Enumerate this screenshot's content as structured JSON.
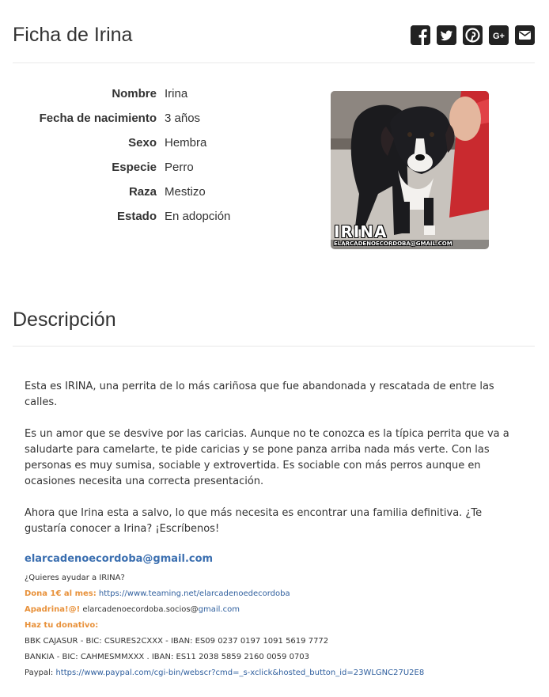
{
  "header": {
    "title": "Ficha de Irina",
    "share_buttons": [
      "facebook-icon",
      "twitter-icon",
      "pinterest-icon",
      "google-plus-icon",
      "email-icon"
    ],
    "gplus_text": "G+"
  },
  "facts": [
    {
      "label": "Nombre",
      "value": "Irina"
    },
    {
      "label": "Fecha de nacimiento",
      "value": "3 años"
    },
    {
      "label": "Sexo",
      "value": "Hembra"
    },
    {
      "label": "Especie",
      "value": "Perro"
    },
    {
      "label": "Raza",
      "value": "Mestizo"
    },
    {
      "label": "Estado",
      "value": "En adopción"
    }
  ],
  "photo": {
    "caption_name": "IRINA",
    "caption_email": "ELARCADENOECORDOBA@GMAIL.COM"
  },
  "description": {
    "title": "Descripción",
    "paragraphs": [
      "Esta es IRINA, una perrita de lo más cariñosa que fue abandonada y rescatada de entre las calles.",
      "Es un amor que se desvive por las caricias. Aunque no te conozca es la típica perrita que va a saludarte para camelarte, te pide caricias y se pone panza arriba nada más verte. Con las personas es muy sumisa, sociable y extrovertida. Es sociable con más perros aunque en ocasiones necesita una correcta presentación.",
      "Ahora que Irina esta a salvo, lo que más necesita es encontrar una familia definitiva. ¿Te gustaría conocer a Irina? ¡Escríbenos!"
    ],
    "email": "elarcadenoecordoba@gmail.com"
  },
  "help": {
    "question": "¿Quieres ayudar a IRINA?",
    "donate_label": "Dona 1€ al mes:",
    "donate_link": "https://www.teaming.net/elarcadenoedecordoba",
    "sponsor_label": "Apadrina!@!",
    "sponsor_text": "elarcadenoecordoba.socios@",
    "sponsor_link": "gmail.com",
    "donation_label": "Haz tu donativo:",
    "bank1": "BBK CAJASUR - BIC: CSURES2CXXX - IBAN: ES09 0237 0197 1091 5619 7772",
    "bank2": "BANKIA - BIC: CAHMESMMXXX . IBAN: ES11 2038 5859 2160 0059 0703",
    "paypal_label": "Paypal:",
    "paypal_link": "https://www.paypal.com/cgi-bin/webscr?cmd=_s-xclick&hosted_button_id=23WLGNC27U2E8"
  }
}
